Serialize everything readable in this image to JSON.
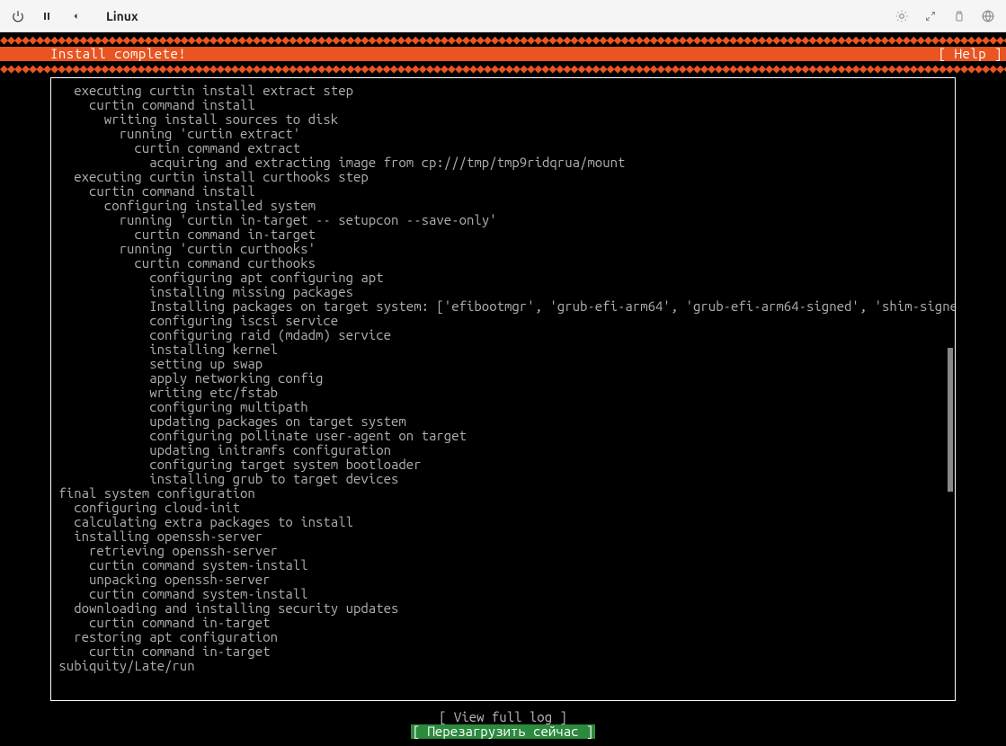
{
  "window": {
    "title": "Linux"
  },
  "diamond_pattern": "◆◆◆◆◆◆◆◆◆◆◆◆◆◆◆◆◆◆◆◆◆◆◆◆◆◆◆◆◆◆◆◆◆◆◆◆◆◆◆◆◆◆◆◆◆◆◆◆◆◆◆◆◆◆◆◆◆◆◆◆◆◆◆◆◆◆◆◆◆◆◆◆◆◆◆◆◆◆◆◆◆◆◆◆◆◆◆◆◆◆◆◆◆◆◆◆◆◆◆◆◆◆◆◆◆◆◆◆◆◆◆◆◆◆◆◆◆◆◆◆◆◆◆◆◆◆◆◆◆◆◆◆◆◆◆◆◆◆◆◆◆◆◆◆◆◆◆◆◆◆",
  "header": {
    "title": "Install complete!",
    "help": "[ Help ]"
  },
  "log_text": "   executing curtin install extract step\n     curtin command install\n       writing install sources to disk\n         running 'curtin extract'\n           curtin command extract\n             acquiring and extracting image from cp:///tmp/tmp9ridqrua/mount\n   executing curtin install curthooks step\n     curtin command install\n       configuring installed system\n         running 'curtin in-target -- setupcon --save-only'\n           curtin command in-target\n         running 'curtin curthooks'\n           curtin command curthooks\n             configuring apt configuring apt\n             installing missing packages\n             Installing packages on target system: ['efibootmgr', 'grub-efi-arm64', 'grub-efi-arm64-signed', 'shim-signed']\n             configuring iscsi service\n             configuring raid (mdadm) service\n             installing kernel\n             setting up swap\n             apply networking config\n             writing etc/fstab\n             configuring multipath\n             updating packages on target system\n             configuring pollinate user-agent on target\n             updating initramfs configuration\n             configuring target system bootloader\n             installing grub to target devices\n final system configuration\n   configuring cloud-init\n   calculating extra packages to install\n   installing openssh-server\n     retrieving openssh-server\n     curtin command system-install\n     unpacking openssh-server\n     curtin command system-install\n   downloading and installing security updates\n     curtin command in-target\n   restoring apt configuration\n     curtin command in-target\n subiquity/Late/run",
  "buttons": {
    "view_log": "[ View full log         ]",
    "reboot": "[ Перезагрузить сейчас ]"
  },
  "colors": {
    "accent": "#e95420",
    "select": "#2b8a3e"
  }
}
